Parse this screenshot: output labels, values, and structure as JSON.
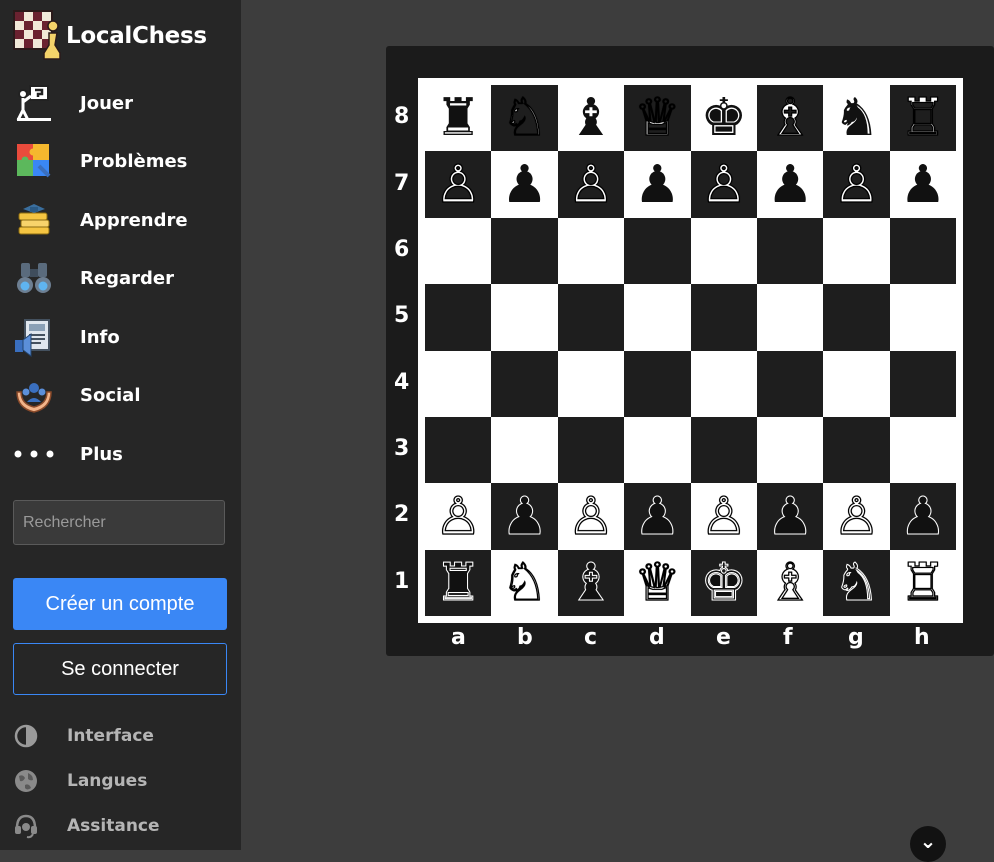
{
  "brand": {
    "name": "LocalChess"
  },
  "nav": [
    {
      "label": "Jouer",
      "icon": "play-chess-icon"
    },
    {
      "label": "Problèmes",
      "icon": "puzzle-icon"
    },
    {
      "label": "Apprendre",
      "icon": "learn-books-icon"
    },
    {
      "label": "Regarder",
      "icon": "binoculars-icon"
    },
    {
      "label": "Info",
      "icon": "news-icon"
    },
    {
      "label": "Social",
      "icon": "community-icon"
    },
    {
      "label": "Plus",
      "icon": "more-dots-icon"
    }
  ],
  "search": {
    "placeholder": "Rechercher"
  },
  "buttons": {
    "signup": "Créer un compte",
    "login": "Se connecter"
  },
  "footer": [
    {
      "label": "Interface",
      "icon": "contrast-icon"
    },
    {
      "label": "Langues",
      "icon": "globe-icon"
    },
    {
      "label": "Assitance",
      "icon": "headset-icon"
    }
  ],
  "board": {
    "ranks": [
      "8",
      "7",
      "6",
      "5",
      "4",
      "3",
      "2",
      "1"
    ],
    "files": [
      "a",
      "b",
      "c",
      "d",
      "e",
      "f",
      "g",
      "h"
    ],
    "position": [
      [
        "♜",
        "♘",
        "♝",
        "♕",
        "♚",
        "♗",
        "♞",
        "♖"
      ],
      [
        "♙",
        "♟",
        "♙",
        "♟",
        "♙",
        "♟",
        "♙",
        "♟"
      ],
      [
        "",
        "",
        "",
        "",
        "",
        "",
        "",
        ""
      ],
      [
        "",
        "",
        "",
        "",
        "",
        "",
        "",
        ""
      ],
      [
        "",
        "",
        "",
        "",
        "",
        "",
        "",
        ""
      ],
      [
        "",
        "",
        "",
        "",
        "",
        "",
        "",
        ""
      ],
      [
        "♙",
        "♟",
        "♙",
        "♟",
        "♙",
        "♟",
        "♙",
        "♟"
      ],
      [
        "♜",
        "♘",
        "♝",
        "♕",
        "♚",
        "♗",
        "♞",
        "♖"
      ]
    ]
  },
  "colors": {
    "accent": "#3a87f5",
    "sidebar": "#262626",
    "background": "#3d3d3d"
  }
}
